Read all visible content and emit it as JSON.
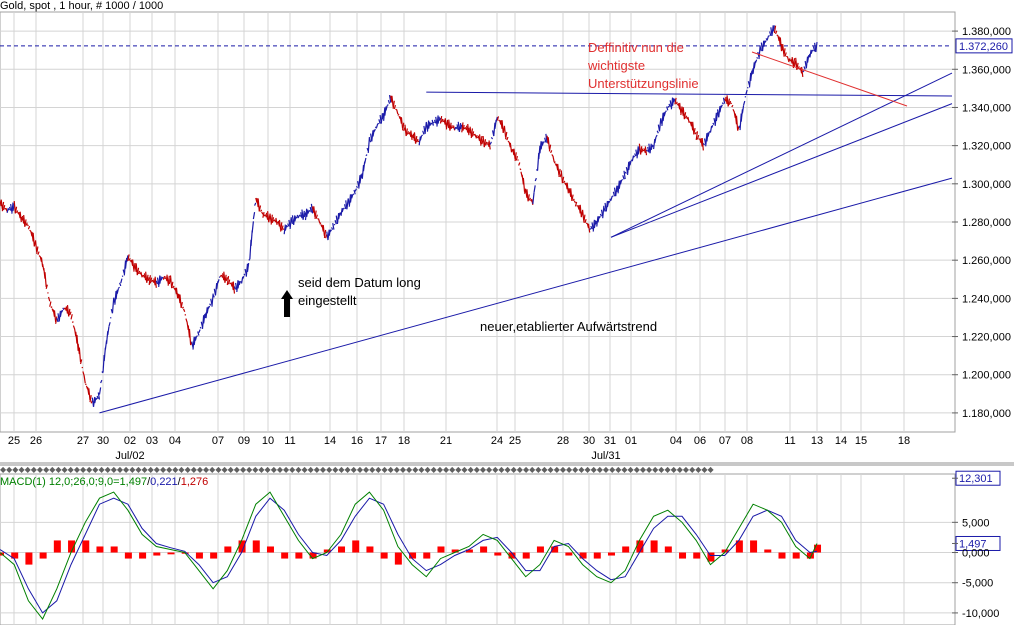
{
  "chart_data": [
    {
      "type": "line",
      "title": "Gold, spot , 1 hour, # 1000 / 1000",
      "y_ticks": [
        "1.380,000",
        "1.360,000",
        "1.340,000",
        "1.320,000",
        "1.300,000",
        "1.280,000",
        "1.260,000",
        "1.240,000",
        "1.220,000",
        "1.200,000",
        "1.180,000"
      ],
      "y_tick_values": [
        1380,
        1360,
        1340,
        1320,
        1300,
        1280,
        1260,
        1240,
        1220,
        1200,
        1180
      ],
      "ylim": [
        1170,
        1390
      ],
      "last_price_label": "1.372,260",
      "last_price": 1372.26,
      "x_day_labels": [
        "25",
        "26",
        "27",
        "30",
        "02",
        "03",
        "04",
        "07",
        "09",
        "10",
        "11",
        "14",
        "16",
        "17",
        "18",
        "21",
        "24",
        "25",
        "28",
        "30",
        "31",
        "01",
        "04",
        "06",
        "07",
        "08",
        "11",
        "13",
        "14",
        "15",
        "18"
      ],
      "x_month_labels": [
        "Jul/02",
        "Jul/31"
      ],
      "price_path": [
        [
          0,
          1290
        ],
        [
          1,
          1286
        ],
        [
          2,
          1288
        ],
        [
          3,
          1282
        ],
        [
          4,
          1278
        ],
        [
          5,
          1268
        ],
        [
          6,
          1258
        ],
        [
          7,
          1238
        ],
        [
          8,
          1228
        ],
        [
          9,
          1235
        ],
        [
          10,
          1232
        ],
        [
          11,
          1215
        ],
        [
          12,
          1196
        ],
        [
          13,
          1185
        ],
        [
          14,
          1189
        ],
        [
          15,
          1218
        ],
        [
          16,
          1238
        ],
        [
          17,
          1248
        ],
        [
          18,
          1262
        ],
        [
          19,
          1256
        ],
        [
          20,
          1252
        ],
        [
          21,
          1250
        ],
        [
          22,
          1248
        ],
        [
          23,
          1251
        ],
        [
          24,
          1249
        ],
        [
          25,
          1242
        ],
        [
          26,
          1233
        ],
        [
          27,
          1215
        ],
        [
          28,
          1222
        ],
        [
          29,
          1232
        ],
        [
          30,
          1240
        ],
        [
          31,
          1252
        ],
        [
          32,
          1250
        ],
        [
          33,
          1245
        ],
        [
          34,
          1249
        ],
        [
          35,
          1257
        ],
        [
          36,
          1292
        ],
        [
          37,
          1284
        ],
        [
          38,
          1282
        ],
        [
          39,
          1280
        ],
        [
          40,
          1276
        ],
        [
          41,
          1280
        ],
        [
          42,
          1283
        ],
        [
          43,
          1284
        ],
        [
          44,
          1287
        ],
        [
          45,
          1280
        ],
        [
          46,
          1272
        ],
        [
          47,
          1278
        ],
        [
          48,
          1285
        ],
        [
          49,
          1290
        ],
        [
          50,
          1296
        ],
        [
          51,
          1305
        ],
        [
          52,
          1322
        ],
        [
          53,
          1330
        ],
        [
          54,
          1336
        ],
        [
          55,
          1345
        ],
        [
          56,
          1337
        ],
        [
          57,
          1328
        ],
        [
          58,
          1325
        ],
        [
          59,
          1322
        ],
        [
          60,
          1330
        ],
        [
          61,
          1332
        ],
        [
          62,
          1334
        ],
        [
          63,
          1331
        ],
        [
          64,
          1329
        ],
        [
          65,
          1330
        ],
        [
          66,
          1328
        ],
        [
          67,
          1325
        ],
        [
          68,
          1322
        ],
        [
          69,
          1320
        ],
        [
          70,
          1335
        ],
        [
          71,
          1328
        ],
        [
          72,
          1318
        ],
        [
          73,
          1312
        ],
        [
          74,
          1295
        ],
        [
          75,
          1290
        ],
        [
          76,
          1319
        ],
        [
          77,
          1324
        ],
        [
          78,
          1312
        ],
        [
          79,
          1304
        ],
        [
          80,
          1297
        ],
        [
          81,
          1290
        ],
        [
          82,
          1284
        ],
        [
          83,
          1276
        ],
        [
          84,
          1280
        ],
        [
          85,
          1286
        ],
        [
          86,
          1292
        ],
        [
          87,
          1298
        ],
        [
          88,
          1305
        ],
        [
          89,
          1313
        ],
        [
          90,
          1318
        ],
        [
          91,
          1317
        ],
        [
          92,
          1320
        ],
        [
          93,
          1332
        ],
        [
          94,
          1340
        ],
        [
          95,
          1344
        ],
        [
          96,
          1338
        ],
        [
          97,
          1333
        ],
        [
          98,
          1326
        ],
        [
          99,
          1320
        ],
        [
          100,
          1328
        ],
        [
          101,
          1336
        ],
        [
          102,
          1344
        ],
        [
          103,
          1342
        ],
        [
          104,
          1328
        ],
        [
          105,
          1347
        ],
        [
          106,
          1360
        ],
        [
          107,
          1370
        ],
        [
          108,
          1376
        ],
        [
          109,
          1382
        ],
        [
          110,
          1372
        ],
        [
          111,
          1365
        ],
        [
          112,
          1363
        ],
        [
          113,
          1358
        ],
        [
          114,
          1368
        ],
        [
          115,
          1372.26
        ]
      ],
      "annotations": [
        {
          "text": "Deffinitiv nun die",
          "color": "#e03030"
        },
        {
          "text": "wichtigste",
          "color": "#e03030"
        },
        {
          "text": "Unterstützungslinie",
          "color": "#e03030"
        },
        {
          "text": "seid dem Datum long",
          "color": "#000000"
        },
        {
          "text": "eingestellt",
          "color": "#000000"
        },
        {
          "text": "neuer,etablierter Aufwärtstrend",
          "color": "#000000"
        }
      ],
      "trendlines": [
        {
          "from": [
            14,
            1180
          ],
          "to": [
            134,
            1303
          ]
        },
        {
          "from": [
            86,
            1272
          ],
          "to": [
            134,
            1342
          ]
        },
        {
          "from": [
            86,
            1272
          ],
          "to": [
            134,
            1358
          ]
        },
        {
          "from": [
            60,
            1348
          ],
          "to": [
            134,
            1346
          ]
        }
      ],
      "colors": {
        "trendline": "#1a1aa8",
        "annotation_red": "#e03030",
        "price_up": "#1a1aa8",
        "price_down": "#c00000",
        "dashed": "#1a1aa8",
        "grid": "#d4d4d4"
      }
    },
    {
      "type": "line",
      "title": "MACD(1) 12,0;26,0;9,0=1,497/0,221/1,276",
      "legend_parts": [
        {
          "text": "MACD(1) 12,0;26,0;9,0=",
          "color": "#008000"
        },
        {
          "text": "1,497",
          "color": "#008000"
        },
        {
          "text": "/",
          "color": "#000000"
        },
        {
          "text": "0,221",
          "color": "#1a1aa8"
        },
        {
          "text": "/",
          "color": "#000000"
        },
        {
          "text": "1,276",
          "color": "#c00000"
        }
      ],
      "y_ticks": [
        "12,301",
        "5,000",
        "1,497",
        "0,000",
        "-5,000",
        "-10,000"
      ],
      "y_tick_values": [
        12.301,
        5,
        1.497,
        0,
        -5,
        -10
      ],
      "ylim": [
        -12,
        13
      ],
      "macd_path": [
        [
          0,
          0
        ],
        [
          2,
          -2
        ],
        [
          4,
          -8
        ],
        [
          6,
          -11
        ],
        [
          8,
          -6
        ],
        [
          10,
          0
        ],
        [
          12,
          5
        ],
        [
          14,
          9
        ],
        [
          16,
          10
        ],
        [
          18,
          7
        ],
        [
          20,
          3
        ],
        [
          22,
          1
        ],
        [
          24,
          0.5
        ],
        [
          26,
          0
        ],
        [
          28,
          -3
        ],
        [
          30,
          -6
        ],
        [
          32,
          -3
        ],
        [
          34,
          2
        ],
        [
          36,
          8
        ],
        [
          38,
          10
        ],
        [
          40,
          6
        ],
        [
          42,
          2
        ],
        [
          44,
          -1
        ],
        [
          46,
          0
        ],
        [
          48,
          3
        ],
        [
          50,
          8
        ],
        [
          52,
          10
        ],
        [
          54,
          7
        ],
        [
          56,
          1
        ],
        [
          58,
          -2
        ],
        [
          60,
          -4
        ],
        [
          62,
          -1
        ],
        [
          64,
          0
        ],
        [
          66,
          1
        ],
        [
          68,
          3
        ],
        [
          70,
          2
        ],
        [
          72,
          -1
        ],
        [
          74,
          -4
        ],
        [
          76,
          -2
        ],
        [
          78,
          2
        ],
        [
          80,
          1
        ],
        [
          82,
          -2
        ],
        [
          84,
          -4
        ],
        [
          86,
          -5
        ],
        [
          88,
          -3
        ],
        [
          90,
          2
        ],
        [
          92,
          6
        ],
        [
          94,
          7
        ],
        [
          96,
          5
        ],
        [
          98,
          2
        ],
        [
          100,
          -2
        ],
        [
          102,
          0
        ],
        [
          104,
          4
        ],
        [
          106,
          8
        ],
        [
          108,
          7
        ],
        [
          110,
          5
        ],
        [
          112,
          1
        ],
        [
          114,
          -1
        ],
        [
          115,
          1.5
        ]
      ],
      "signal_path": [
        [
          0,
          0.5
        ],
        [
          2,
          -1
        ],
        [
          4,
          -6
        ],
        [
          6,
          -10
        ],
        [
          8,
          -8
        ],
        [
          10,
          -2
        ],
        [
          12,
          3
        ],
        [
          14,
          8
        ],
        [
          16,
          9
        ],
        [
          18,
          8
        ],
        [
          20,
          4
        ],
        [
          22,
          1.5
        ],
        [
          24,
          0.8
        ],
        [
          26,
          0.2
        ],
        [
          28,
          -2
        ],
        [
          30,
          -5
        ],
        [
          32,
          -4
        ],
        [
          34,
          0
        ],
        [
          36,
          6
        ],
        [
          38,
          9
        ],
        [
          40,
          7
        ],
        [
          42,
          3
        ],
        [
          44,
          0
        ],
        [
          46,
          -0.5
        ],
        [
          48,
          2
        ],
        [
          50,
          6
        ],
        [
          52,
          9
        ],
        [
          54,
          8
        ],
        [
          56,
          3
        ],
        [
          58,
          -1
        ],
        [
          60,
          -3
        ],
        [
          62,
          -2
        ],
        [
          64,
          -0.5
        ],
        [
          66,
          0.5
        ],
        [
          68,
          2
        ],
        [
          70,
          2.5
        ],
        [
          72,
          0
        ],
        [
          74,
          -3
        ],
        [
          76,
          -3
        ],
        [
          78,
          1
        ],
        [
          80,
          1.5
        ],
        [
          82,
          -1
        ],
        [
          84,
          -3
        ],
        [
          86,
          -4.5
        ],
        [
          88,
          -4
        ],
        [
          90,
          0
        ],
        [
          92,
          4
        ],
        [
          94,
          6
        ],
        [
          96,
          6
        ],
        [
          98,
          3
        ],
        [
          100,
          -0.5
        ],
        [
          102,
          -0.5
        ],
        [
          104,
          2
        ],
        [
          106,
          6
        ],
        [
          108,
          7
        ],
        [
          110,
          6
        ],
        [
          112,
          2
        ],
        [
          114,
          0
        ],
        [
          115,
          0.2
        ]
      ],
      "histogram": [
        [
          0,
          -0.5
        ],
        [
          2,
          -1
        ],
        [
          4,
          -2
        ],
        [
          6,
          -1
        ],
        [
          8,
          2
        ],
        [
          10,
          2
        ],
        [
          12,
          2
        ],
        [
          14,
          1
        ],
        [
          16,
          1
        ],
        [
          18,
          -1
        ],
        [
          20,
          -1
        ],
        [
          22,
          -0.5
        ],
        [
          24,
          -0.3
        ],
        [
          26,
          -0.2
        ],
        [
          28,
          -1
        ],
        [
          30,
          -1
        ],
        [
          32,
          1
        ],
        [
          34,
          2
        ],
        [
          36,
          2
        ],
        [
          38,
          1
        ],
        [
          40,
          -1
        ],
        [
          42,
          -1
        ],
        [
          44,
          -1
        ],
        [
          46,
          0.5
        ],
        [
          48,
          1
        ],
        [
          50,
          2
        ],
        [
          52,
          1
        ],
        [
          54,
          -1
        ],
        [
          56,
          -2
        ],
        [
          58,
          -1
        ],
        [
          60,
          -1
        ],
        [
          62,
          1
        ],
        [
          64,
          0.5
        ],
        [
          66,
          0.5
        ],
        [
          68,
          1
        ],
        [
          70,
          -0.5
        ],
        [
          72,
          -1
        ],
        [
          74,
          -1
        ],
        [
          76,
          1
        ],
        [
          78,
          1
        ],
        [
          80,
          -0.5
        ],
        [
          82,
          -1
        ],
        [
          84,
          -1
        ],
        [
          86,
          -0.5
        ],
        [
          88,
          1
        ],
        [
          90,
          2
        ],
        [
          92,
          2
        ],
        [
          94,
          1
        ],
        [
          96,
          -1
        ],
        [
          98,
          -1
        ],
        [
          100,
          -1.5
        ],
        [
          102,
          0.5
        ],
        [
          104,
          2
        ],
        [
          106,
          2
        ],
        [
          108,
          0.5
        ],
        [
          110,
          -1
        ],
        [
          112,
          -1
        ],
        [
          114,
          -1
        ],
        [
          115,
          1.3
        ]
      ],
      "colors": {
        "macd": "#008000",
        "signal": "#1a1aa8",
        "histogram": "#ff0000"
      }
    }
  ]
}
